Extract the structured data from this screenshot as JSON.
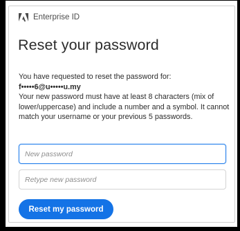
{
  "brand": {
    "name": "Enterprise ID",
    "logo_icon": "adobe-logo-icon"
  },
  "title": "Reset your password",
  "message": {
    "intro": "You have requested to reset the password for:",
    "email": "f•••••6@u•••••u.my",
    "rules": "Your new password must have at least 8 characters (mix of lower/uppercase) and include a number and a symbol. It cannot match your username or your previous 5 passwords."
  },
  "fields": {
    "new_password": {
      "placeholder": "New password",
      "value": ""
    },
    "retype_password": {
      "placeholder": "Retype new password",
      "value": ""
    }
  },
  "submit_label": "Reset my password",
  "colors": {
    "accent": "#1473e6",
    "focus": "#2680eb",
    "logo": "#4b4b4b"
  }
}
